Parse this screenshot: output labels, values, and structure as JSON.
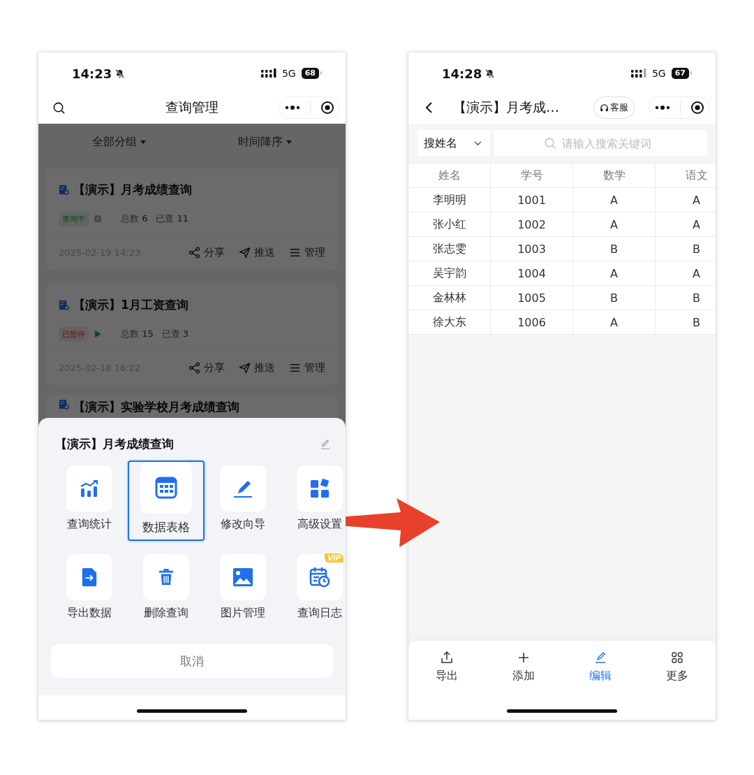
{
  "left_phone": {
    "status_bar": {
      "time": "14:23",
      "network": "5G",
      "battery": "68"
    },
    "nav": {
      "title": "查询管理"
    },
    "filters": [
      {
        "label": "全部分组"
      },
      {
        "label": "时间降序"
      }
    ],
    "queries": [
      {
        "title": "【演示】月考成绩查询",
        "status": {
          "label": "查询中",
          "kind": "running"
        },
        "total_label": "总数",
        "total": "6",
        "checked_label": "已查",
        "checked": "11",
        "date": "2025-02-19 14:23",
        "actions": [
          {
            "label": "分享",
            "kind": "share"
          },
          {
            "label": "推送",
            "kind": "send"
          },
          {
            "label": "管理",
            "kind": "menu"
          }
        ]
      },
      {
        "title": "【演示】1月工资查询",
        "status": {
          "label": "已暂停",
          "kind": "paused"
        },
        "total_label": "总数",
        "total": "15",
        "checked_label": "已查",
        "checked": "3",
        "date": "2025-02-18 16:22",
        "actions": [
          {
            "label": "分享",
            "kind": "share"
          },
          {
            "label": "推送",
            "kind": "send"
          },
          {
            "label": "管理",
            "kind": "menu"
          }
        ]
      }
    ],
    "partial_query": {
      "title": "【演示】实验学校月考成绩查询"
    },
    "action_sheet": {
      "title": "【演示】月考成绩查询",
      "items": [
        {
          "label": "查询统计",
          "kind": "chart",
          "selected": false
        },
        {
          "label": "数据表格",
          "kind": "table",
          "selected": true
        },
        {
          "label": "修改向导",
          "kind": "pen",
          "selected": false
        },
        {
          "label": "高级设置",
          "kind": "blocks",
          "selected": false
        },
        {
          "label": "导出数据",
          "kind": "export",
          "selected": false
        },
        {
          "label": "删除查询",
          "kind": "trash",
          "selected": false
        },
        {
          "label": "图片管理",
          "kind": "image",
          "selected": false
        },
        {
          "label": "查询日志",
          "kind": "calendar",
          "selected": false,
          "badge": "VIP"
        }
      ],
      "cancel": "取消"
    }
  },
  "right_phone": {
    "status_bar": {
      "time": "14:28",
      "network": "5G",
      "battery": "67"
    },
    "nav": {
      "title": "【演示】月考成…",
      "service_button": "客服"
    },
    "search": {
      "field_select": "搜姓名",
      "placeholder": "请输入搜索关键词"
    },
    "table": {
      "columns": [
        "姓名",
        "学号",
        "数学",
        "语文"
      ],
      "rows": [
        [
          "李明明",
          "1001",
          "A",
          "A"
        ],
        [
          "张小红",
          "1002",
          "A",
          "A"
        ],
        [
          "张志雯",
          "1003",
          "B",
          "B"
        ],
        [
          "吴宇韵",
          "1004",
          "A",
          "A"
        ],
        [
          "金林林",
          "1005",
          "B",
          "B"
        ],
        [
          "徐大东",
          "1006",
          "A",
          "B"
        ]
      ]
    },
    "toolbar": [
      {
        "label": "导出",
        "kind": "export",
        "selected": false
      },
      {
        "label": "添加",
        "kind": "add",
        "selected": false
      },
      {
        "label": "编辑",
        "kind": "edit",
        "selected": true
      },
      {
        "label": "更多",
        "kind": "more",
        "selected": false
      }
    ]
  }
}
